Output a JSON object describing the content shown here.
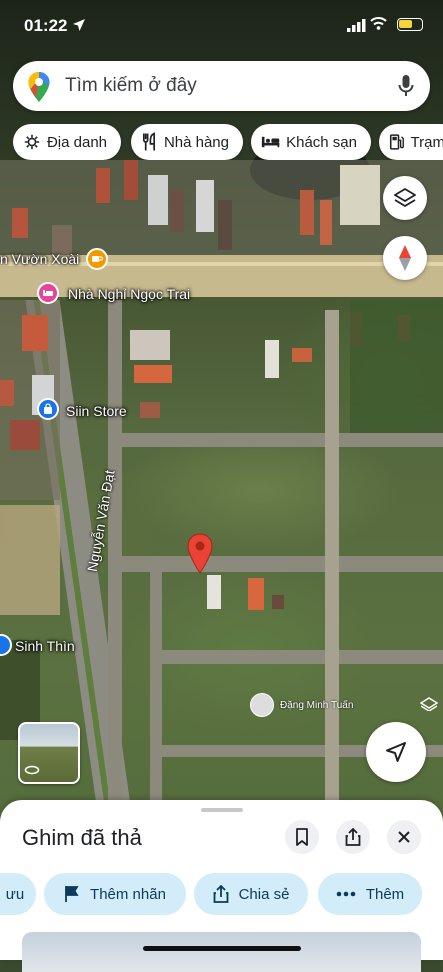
{
  "status_bar": {
    "time": "01:22"
  },
  "search": {
    "placeholder": "Tìm kiếm ở đây"
  },
  "chips": [
    {
      "label": "Địa danh",
      "icon": "landmark-icon"
    },
    {
      "label": "Nhà hàng",
      "icon": "restaurant-icon"
    },
    {
      "label": "Khách sạn",
      "icon": "hotel-icon"
    },
    {
      "label": "Trạm",
      "icon": "gas-station-icon"
    }
  ],
  "map": {
    "places": [
      {
        "label": "n Vườn Xoài",
        "icon": "cafe-icon",
        "color": "#f29900"
      },
      {
        "label": "Nhà Nghỉ Ngọc Trai",
        "icon": "bed-icon",
        "color": "#e8449a"
      },
      {
        "label": "Siin Store",
        "icon": "shopping-bag-icon",
        "color": "#1a73e8"
      },
      {
        "label": "Sinh Thìn",
        "icon": "place-icon",
        "color": "#1a73e8"
      }
    ],
    "street": "Nguyễn Văn Đạt",
    "contributor": "Đặng Minh Tuấn",
    "pin_color": "#ea4335"
  },
  "sheet": {
    "title": "Ghim đã thả",
    "actions": [
      {
        "label": "ưu",
        "icon": "save-icon"
      },
      {
        "label": "Thêm nhãn",
        "icon": "flag-icon"
      },
      {
        "label": "Chia sẻ",
        "icon": "share-icon"
      },
      {
        "label": "Thêm",
        "icon": "more-icon"
      }
    ]
  },
  "colors": {
    "action_bg": "#d2ecf9",
    "action_text": "#0b3a5c",
    "accent": "#1a73e8"
  }
}
